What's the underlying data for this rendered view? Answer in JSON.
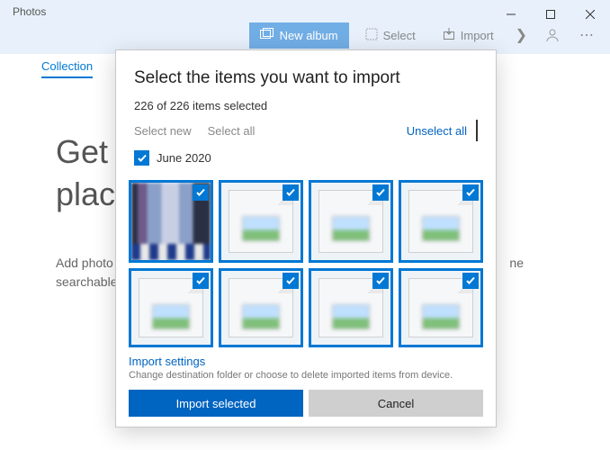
{
  "app": {
    "title": "Photos"
  },
  "toolbar": {
    "new_album": "New album",
    "select": "Select",
    "import": "Import"
  },
  "tabs": {
    "collection": "Collection"
  },
  "background": {
    "headline_line1": "Get a",
    "headline_line2": "place",
    "subtext_prefix": "Add photo",
    "subtext_line2": "searchable",
    "subtext_suffix": "ne"
  },
  "dialog": {
    "title": "Select the items you want to import",
    "count_text": "226 of 226 items selected",
    "select_new": "Select new",
    "select_all": "Select all",
    "unselect_all": "Unselect all",
    "group_label": "June 2020",
    "group_checked": true,
    "thumbs": [
      {
        "selected": true,
        "variant": "real"
      },
      {
        "selected": true,
        "variant": "generic"
      },
      {
        "selected": true,
        "variant": "generic"
      },
      {
        "selected": true,
        "variant": "generic"
      },
      {
        "selected": true,
        "variant": "generic"
      },
      {
        "selected": true,
        "variant": "generic"
      },
      {
        "selected": true,
        "variant": "generic"
      },
      {
        "selected": true,
        "variant": "generic"
      }
    ],
    "import_settings_label": "Import settings",
    "import_settings_desc": "Change destination folder or choose to delete imported items from device.",
    "import_button": "Import selected",
    "cancel_button": "Cancel"
  },
  "colors": {
    "accent": "#0078d4",
    "link": "#0064c1"
  }
}
